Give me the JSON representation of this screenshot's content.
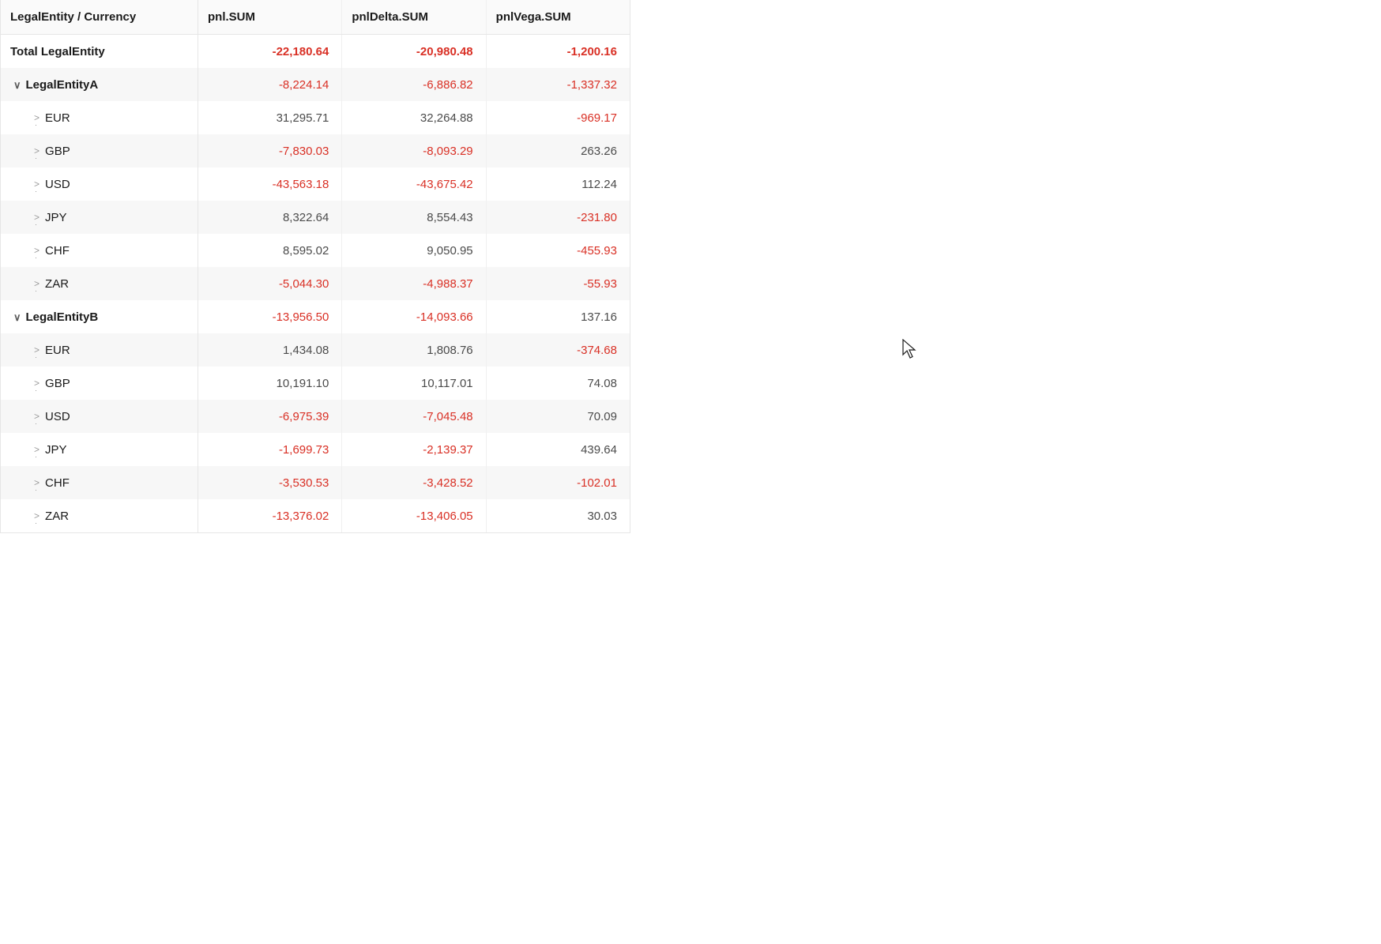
{
  "columns": {
    "dim_header": "LegalEntity / Currency",
    "m1": "pnl.SUM",
    "m2": "pnlDelta.SUM",
    "m3": "pnlVega.SUM"
  },
  "total": {
    "label": "Total LegalEntity",
    "m1": "-22,180.64",
    "m2": "-20,980.48",
    "m3": "-1,200.16"
  },
  "entities": [
    {
      "label": "LegalEntityA",
      "m1": "-8,224.14",
      "m2": "-6,886.82",
      "m3": "-1,337.32",
      "children": [
        {
          "label": "EUR",
          "m1": "31,295.71",
          "m2": "32,264.88",
          "m3": "-969.17"
        },
        {
          "label": "GBP",
          "m1": "-7,830.03",
          "m2": "-8,093.29",
          "m3": "263.26"
        },
        {
          "label": "USD",
          "m1": "-43,563.18",
          "m2": "-43,675.42",
          "m3": "112.24"
        },
        {
          "label": "JPY",
          "m1": "8,322.64",
          "m2": "8,554.43",
          "m3": "-231.80"
        },
        {
          "label": "CHF",
          "m1": "8,595.02",
          "m2": "9,050.95",
          "m3": "-455.93"
        },
        {
          "label": "ZAR",
          "m1": "-5,044.30",
          "m2": "-4,988.37",
          "m3": "-55.93"
        }
      ]
    },
    {
      "label": "LegalEntityB",
      "m1": "-13,956.50",
      "m2": "-14,093.66",
      "m3": "137.16",
      "children": [
        {
          "label": "EUR",
          "m1": "1,434.08",
          "m2": "1,808.76",
          "m3": "-374.68"
        },
        {
          "label": "GBP",
          "m1": "10,191.10",
          "m2": "10,117.01",
          "m3": "74.08"
        },
        {
          "label": "USD",
          "m1": "-6,975.39",
          "m2": "-7,045.48",
          "m3": "70.09"
        },
        {
          "label": "JPY",
          "m1": "-1,699.73",
          "m2": "-2,139.37",
          "m3": "439.64"
        },
        {
          "label": "CHF",
          "m1": "-3,530.53",
          "m2": "-3,428.52",
          "m3": "-102.01"
        },
        {
          "label": "ZAR",
          "m1": "-13,376.02",
          "m2": "-13,406.05",
          "m3": "30.03"
        }
      ]
    }
  ]
}
